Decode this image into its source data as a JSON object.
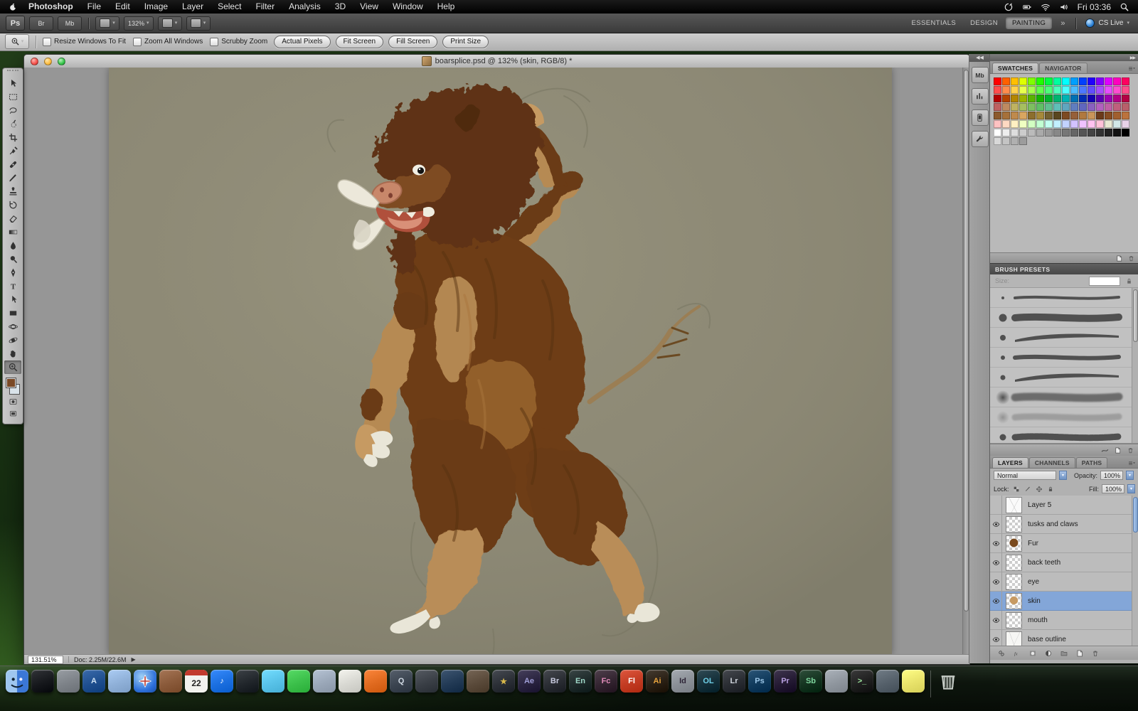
{
  "menu_bar": {
    "items": [
      "Photoshop",
      "File",
      "Edit",
      "Image",
      "Layer",
      "Select",
      "Filter",
      "Analysis",
      "3D",
      "View",
      "Window",
      "Help"
    ],
    "status_icons": [
      "sync",
      "battery",
      "wifi",
      "volume"
    ],
    "clock": "Fri 03:36"
  },
  "app_bar": {
    "logo": "Ps",
    "br_label": "Br",
    "mb_label": "Mb",
    "zoom_value": "132%",
    "workspaces": [
      "ESSENTIALS",
      "DESIGN",
      "PAINTING"
    ],
    "active_workspace": "PAINTING",
    "overflow": "»",
    "cs_live_label": "CS Live"
  },
  "options_bar": {
    "tool_icon": "zoom",
    "checkboxes": [
      "Resize Windows To Fit",
      "Zoom All Windows",
      "Scrubby Zoom"
    ],
    "buttons": [
      "Actual Pixels",
      "Fit Screen",
      "Fill Screen",
      "Print Size"
    ]
  },
  "window": {
    "title": "boarsplice.psd @ 132% (skin, RGB/8) *",
    "status_zoom": "131.51%",
    "status_doc": "Doc: 2.25M/22.6M"
  },
  "tools": [
    {
      "name": "move-tool",
      "icon": "move"
    },
    {
      "name": "rectangular-marquee-tool",
      "icon": "marquee"
    },
    {
      "name": "lasso-tool",
      "icon": "lasso"
    },
    {
      "name": "quick-selection-tool",
      "icon": "quickselect"
    },
    {
      "name": "crop-tool",
      "icon": "crop"
    },
    {
      "name": "eyedropper-tool",
      "icon": "eyedropper"
    },
    {
      "name": "spot-healing-brush-tool",
      "icon": "healing"
    },
    {
      "name": "brush-tool",
      "icon": "brush"
    },
    {
      "name": "clone-stamp-tool",
      "icon": "stamp"
    },
    {
      "name": "history-brush-tool",
      "icon": "history"
    },
    {
      "name": "eraser-tool",
      "icon": "eraser"
    },
    {
      "name": "gradient-tool",
      "icon": "gradient"
    },
    {
      "name": "blur-tool",
      "icon": "blur"
    },
    {
      "name": "dodge-tool",
      "icon": "dodge"
    },
    {
      "name": "pen-tool",
      "icon": "pen"
    },
    {
      "name": "type-tool",
      "icon": "type"
    },
    {
      "name": "path-selection-tool",
      "icon": "pathselect"
    },
    {
      "name": "rectangle-shape-tool",
      "icon": "shape"
    },
    {
      "name": "3d-object-rotate-tool",
      "icon": "rot3d"
    },
    {
      "name": "3d-camera-rotate-tool",
      "icon": "orb3d"
    },
    {
      "name": "hand-tool",
      "icon": "hand"
    },
    {
      "name": "zoom-tool",
      "icon": "zoom",
      "active": true
    }
  ],
  "colors": {
    "foreground": "#7a4a26",
    "background": "#d9e3e9"
  },
  "side_strip": [
    {
      "name": "mini-bridge-panel-button",
      "label": "Mb"
    },
    {
      "name": "histogram-panel-button",
      "icon": "histogram"
    },
    {
      "name": "device-central-panel-button",
      "icon": "device"
    },
    {
      "name": "tools-presets-panel-button",
      "icon": "wrench"
    }
  ],
  "swatches_panel": {
    "tabs": [
      "SWATCHES",
      "NAVIGATOR"
    ],
    "active_tab": "SWATCHES",
    "colors": [
      "#ff0000",
      "#ff6000",
      "#ffbf00",
      "#dfff00",
      "#80ff00",
      "#20ff00",
      "#00ff40",
      "#00ff9f",
      "#00ffff",
      "#009fff",
      "#0040ff",
      "#2000ff",
      "#8000ff",
      "#df00ff",
      "#ff00bf",
      "#ff0060",
      "#ff4d4d",
      "#ff8c4d",
      "#ffd24d",
      "#e8ff4d",
      "#a6ff4d",
      "#63ff4d",
      "#4dff79",
      "#4dffbc",
      "#4dffff",
      "#4dbcff",
      "#4d79ff",
      "#634dff",
      "#a64dff",
      "#e84dff",
      "#ff4dd2",
      "#ff4d8c",
      "#b30000",
      "#b34300",
      "#b38600",
      "#9cb300",
      "#59b300",
      "#16b300",
      "#00b32d",
      "#00b370",
      "#00b3b3",
      "#0070b3",
      "#002db3",
      "#1600b3",
      "#5900b3",
      "#9c00b3",
      "#b30086",
      "#b30043",
      "#bf6060",
      "#bf8a60",
      "#bfb360",
      "#a6bf60",
      "#7dbf60",
      "#60bf66",
      "#60bf8f",
      "#60bfb8",
      "#60a6bf",
      "#607dbf",
      "#6066bf",
      "#8a60bf",
      "#b360bf",
      "#bf60a6",
      "#bf607d",
      "#b8606a",
      "#8c5a2d",
      "#a6713a",
      "#bf8a4d",
      "#d9a660",
      "#8c6e2d",
      "#a6893a",
      "#736030",
      "#59461f",
      "#7d4a23",
      "#96603a",
      "#b0793f",
      "#c9955a",
      "#6b3a1a",
      "#874c22",
      "#a15f2e",
      "#bb733d",
      "#ffc2c2",
      "#ffd9c2",
      "#fff0c2",
      "#f0ffc2",
      "#d2ffc2",
      "#c2ffd2",
      "#c2fff0",
      "#c2f0ff",
      "#c2d2ff",
      "#d2c2ff",
      "#f0c2ff",
      "#ffc2f0",
      "#ffc2d9",
      "#e8e8d2",
      "#d2e8e8",
      "#e8d2e8",
      "#ffffff",
      "#eeeeee",
      "#dddddd",
      "#cccccc",
      "#bbbbbb",
      "#aaaaaa",
      "#999999",
      "#888888",
      "#777777",
      "#666666",
      "#555555",
      "#444444",
      "#333333",
      "#222222",
      "#111111",
      "#000000",
      "#d8d8d8",
      "#c4c4c4",
      "#b0b0b0",
      "#9c9c9c"
    ]
  },
  "brush_panel": {
    "title": "BRUSH PRESETS",
    "size_label": "Size:",
    "brushes": [
      {
        "dot": 4,
        "stroke": 4,
        "soft": false,
        "taper": false,
        "faint": false
      },
      {
        "dot": 11,
        "stroke": 10,
        "soft": false,
        "taper": false,
        "faint": false
      },
      {
        "dot": 8,
        "stroke": 7,
        "soft": false,
        "taper": true,
        "faint": false
      },
      {
        "dot": 6,
        "stroke": 6,
        "soft": false,
        "taper": false,
        "faint": false
      },
      {
        "dot": 7,
        "stroke": 6,
        "soft": false,
        "taper": true,
        "faint": false
      },
      {
        "dot": 12,
        "stroke": 11,
        "soft": true,
        "taper": false,
        "faint": false
      },
      {
        "dot": 10,
        "stroke": 9,
        "soft": true,
        "taper": false,
        "faint": true
      },
      {
        "dot": 9,
        "stroke": 9,
        "soft": false,
        "taper": false,
        "faint": false,
        "rough": true
      }
    ]
  },
  "layers_panel": {
    "tabs": [
      "LAYERS",
      "CHANNELS",
      "PATHS"
    ],
    "active_tab": "LAYERS",
    "blend_mode": "Normal",
    "opacity_label": "Opacity:",
    "opacity_value": "100%",
    "lock_label": "Lock:",
    "fill_label": "Fill:",
    "fill_value": "100%",
    "layers": [
      {
        "name": "Layer 5",
        "visible": false,
        "thumb": "sketch",
        "selected": false
      },
      {
        "name": "tusks and claws",
        "visible": true,
        "thumb": "checker",
        "selected": false
      },
      {
        "name": "Fur",
        "visible": true,
        "thumb": "fur",
        "selected": false
      },
      {
        "name": "back teeth",
        "visible": true,
        "thumb": "checker",
        "selected": false
      },
      {
        "name": "eye",
        "visible": true,
        "thumb": "checker",
        "selected": false
      },
      {
        "name": "skin",
        "visible": true,
        "thumb": "skin",
        "selected": true
      },
      {
        "name": "mouth",
        "visible": true,
        "thumb": "checker",
        "selected": false
      },
      {
        "name": "base outline",
        "visible": true,
        "thumb": "outline",
        "selected": false
      }
    ]
  },
  "dock": {
    "items": [
      {
        "name": "finder",
        "bg": "#3b77d6",
        "label": "",
        "kind": "finder"
      },
      {
        "name": "dashboard",
        "bg": "#16181c",
        "label": ""
      },
      {
        "name": "system-preferences",
        "bg": "#7d8288",
        "label": ""
      },
      {
        "name": "app-store",
        "bg": "#1f4f8f",
        "label": "A",
        "fg": "#cfe2f4"
      },
      {
        "name": "mail",
        "bg": "#8fb0d8",
        "label": ""
      },
      {
        "name": "safari",
        "bg": "#2d6fd9",
        "label": "",
        "kind": "safari"
      },
      {
        "name": "address-book",
        "bg": "#8a5a3a",
        "label": ""
      },
      {
        "name": "ical",
        "bg": "#f2f2ee",
        "label": "22",
        "kind": "calendar"
      },
      {
        "name": "itunes",
        "bg": "#1b6fe0",
        "label": "♪",
        "fg": "#ffffff"
      },
      {
        "name": "photo-booth",
        "bg": "#21262b",
        "label": ""
      },
      {
        "name": "ichat",
        "bg": "#58c2e8",
        "label": ""
      },
      {
        "name": "facetime",
        "bg": "#3bbf4a",
        "label": ""
      },
      {
        "name": "preview",
        "bg": "#9aa7b8",
        "label": ""
      },
      {
        "name": "textedit",
        "bg": "#d8d8d2",
        "label": ""
      },
      {
        "name": "firefox",
        "bg": "#e06a1f",
        "label": ""
      },
      {
        "name": "quicktime",
        "bg": "#3b4450",
        "label": "Q",
        "fg": "#cfd8e2"
      },
      {
        "name": "dvd-player",
        "bg": "#3a3f46",
        "label": ""
      },
      {
        "name": "time-machine",
        "bg": "#223a55",
        "label": ""
      },
      {
        "name": "garageband",
        "bg": "#5a4a3a",
        "label": ""
      },
      {
        "name": "imovie",
        "bg": "#2b2f36",
        "label": "★",
        "fg": "#d8b84a"
      },
      {
        "name": "adobe-after-effects",
        "bg": "#2a2440",
        "label": "Ae",
        "fg": "#a09fd8"
      },
      {
        "name": "adobe-bridge",
        "bg": "#2a2d33",
        "label": "Br",
        "fg": "#c8cade"
      },
      {
        "name": "adobe-encore",
        "bg": "#1e2a2a",
        "label": "En",
        "fg": "#9fd8c8"
      },
      {
        "name": "adobe-flash-catalyst",
        "bg": "#332430",
        "label": "Fc",
        "fg": "#e08ab8"
      },
      {
        "name": "adobe-flash",
        "bg": "#c23b22",
        "label": "Fl",
        "fg": "#ffffff"
      },
      {
        "name": "adobe-illustrator",
        "bg": "#2a2015",
        "label": "Ai",
        "fg": "#e8a33d"
      },
      {
        "name": "adobe-indesign",
        "bg": "#8a8f96",
        "label": "Id",
        "fg": "#2d2436"
      },
      {
        "name": "adobe-onlocation",
        "bg": "#15303a",
        "label": "OL",
        "fg": "#6fd0e8"
      },
      {
        "name": "adobe-lightroom",
        "bg": "#2a2d33",
        "label": "Lr",
        "fg": "#cfd4dc"
      },
      {
        "name": "adobe-photoshop",
        "bg": "#103a5c",
        "label": "Ps",
        "fg": "#9cc7e8"
      },
      {
        "name": "adobe-premiere",
        "bg": "#241a33",
        "label": "Pr",
        "fg": "#b89fe0"
      },
      {
        "name": "adobe-soundbooth",
        "bg": "#13331f",
        "label": "Sb",
        "fg": "#7fd89f"
      },
      {
        "name": "utilities",
        "bg": "#8f969e",
        "label": ""
      },
      {
        "name": "terminal",
        "bg": "#1f1f1f",
        "label": ">_",
        "fg": "#9fe89f"
      },
      {
        "name": "screen-sharing",
        "bg": "#55606a",
        "label": ""
      },
      {
        "name": "stickies",
        "bg": "#e8e26a",
        "label": ""
      },
      {
        "name": "trash",
        "bg": "",
        "label": "",
        "kind": "trash"
      }
    ]
  }
}
